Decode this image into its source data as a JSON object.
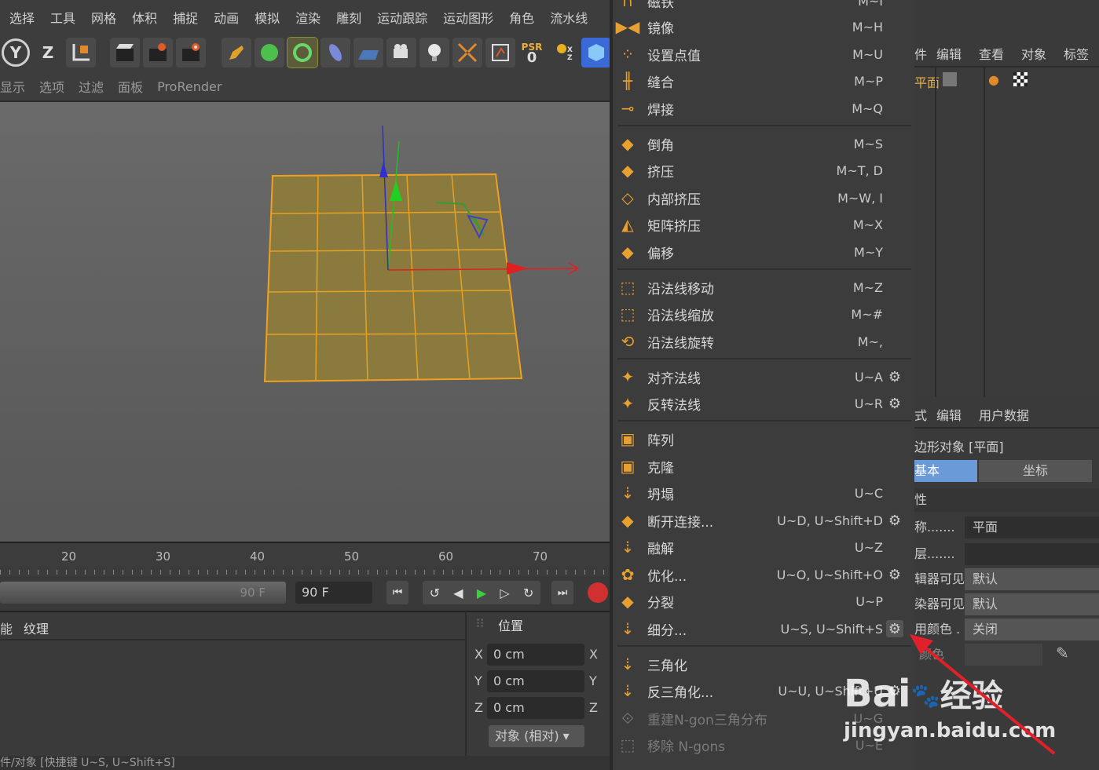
{
  "menubar": [
    "选择",
    "工具",
    "网格",
    "体积",
    "捕捉",
    "动画",
    "模拟",
    "渲染",
    "雕刻",
    "运动跟踪",
    "运动图形",
    "角色",
    "流水线"
  ],
  "toolbar": {
    "axis_y": "Y",
    "axis_z": "Z",
    "psr": "PSR",
    "psr_value": "0"
  },
  "viewbar": [
    "显示",
    "选项",
    "过滤",
    "面板",
    "ProRender"
  ],
  "timeline": {
    "ticks": [
      "20",
      "30",
      "40",
      "50",
      "60",
      "70"
    ],
    "frame_end_label": "90 F",
    "frame_field": "90 F"
  },
  "lower_tabs": {
    "left_partial": "能",
    "texture": "纹理",
    "position": "位置"
  },
  "coords": {
    "x_label": "X",
    "y_label": "Y",
    "z_label": "Z",
    "x_val": "0 cm",
    "y_val": "0 cm",
    "z_val": "0 cm",
    "mode": "对象 (相对)"
  },
  "statusbar": "件/对象 [快捷键 U~S, U~Shift+S]",
  "menu": {
    "top_partial": {
      "label": "磁铁",
      "shortcut": "M~I"
    },
    "items": [
      {
        "label": "镜像",
        "shortcut": "M~H",
        "gear": false
      },
      {
        "label": "设置点值",
        "shortcut": "M~U",
        "gear": false
      },
      {
        "label": "缝合",
        "shortcut": "M~P",
        "gear": false
      },
      {
        "label": "焊接",
        "shortcut": "M~Q",
        "gear": false
      },
      {
        "label": "倒角",
        "shortcut": "M~S",
        "gear": false
      },
      {
        "label": "挤压",
        "shortcut": "M~T, D",
        "gear": false
      },
      {
        "label": "内部挤压",
        "shortcut": "M~W, I",
        "gear": false
      },
      {
        "label": "矩阵挤压",
        "shortcut": "M~X",
        "gear": false
      },
      {
        "label": "偏移",
        "shortcut": "M~Y",
        "gear": false
      },
      {
        "label": "沿法线移动",
        "shortcut": "M~Z",
        "gear": false
      },
      {
        "label": "沿法线缩放",
        "shortcut": "M~#",
        "gear": false
      },
      {
        "label": "沿法线旋转",
        "shortcut": "M~,",
        "gear": false
      },
      {
        "label": "对齐法线",
        "shortcut": "U~A",
        "gear": true
      },
      {
        "label": "反转法线",
        "shortcut": "U~R",
        "gear": true
      },
      {
        "label": "阵列",
        "shortcut": "",
        "gear": false
      },
      {
        "label": "克隆",
        "shortcut": "",
        "gear": false
      },
      {
        "label": "坍塌",
        "shortcut": "U~C",
        "gear": false
      },
      {
        "label": "断开连接...",
        "shortcut": "U~D, U~Shift+D",
        "gear": true
      },
      {
        "label": "融解",
        "shortcut": "U~Z",
        "gear": false
      },
      {
        "label": "优化...",
        "shortcut": "U~O, U~Shift+O",
        "gear": true
      },
      {
        "label": "分裂",
        "shortcut": "U~P",
        "gear": false
      },
      {
        "label": "细分...",
        "shortcut": "U~S, U~Shift+S",
        "gear": true
      },
      {
        "label": "三角化",
        "shortcut": "",
        "gear": false
      },
      {
        "label": "反三角化...",
        "shortcut": "U~U, U~Shift+U",
        "gear": true
      },
      {
        "label": "重建N-gon三角分布",
        "shortcut": "U~G",
        "gear": false
      },
      {
        "label": "移除 N-gons",
        "shortcut": "U~E",
        "gear": false
      }
    ]
  },
  "right": {
    "top_tabs": [
      "件",
      "编辑",
      "查看",
      "对象",
      "标签"
    ],
    "object_name": "平面",
    "attr_tabs": [
      "式",
      "编辑",
      "用户数据"
    ],
    "object_title": "边形对象 [平面]",
    "sub_tabs": [
      "基本",
      "坐标"
    ],
    "section": "性",
    "props": [
      {
        "label": "称.......",
        "value": "平面"
      },
      {
        "label": "层.......",
        "value": ""
      },
      {
        "label": "辑器可见",
        "value": "默认"
      },
      {
        "label": "染器可见",
        "value": "默认"
      },
      {
        "label": "用颜色 . .",
        "value": "关闭"
      },
      {
        "label": "颜色",
        "value": ""
      }
    ]
  },
  "watermark": {
    "brand": "Bai",
    "brand2": "经验",
    "url": "jingyan.baidu.com"
  },
  "colors": {
    "plane_fill": "#8a7a3e",
    "plane_edge": "#f0a020",
    "axis_x": "#e02020",
    "axis_y": "#20c020",
    "axis_z": "#3030c0",
    "accent_tab": "#6a9ad8",
    "arrow": "#e0202a"
  }
}
